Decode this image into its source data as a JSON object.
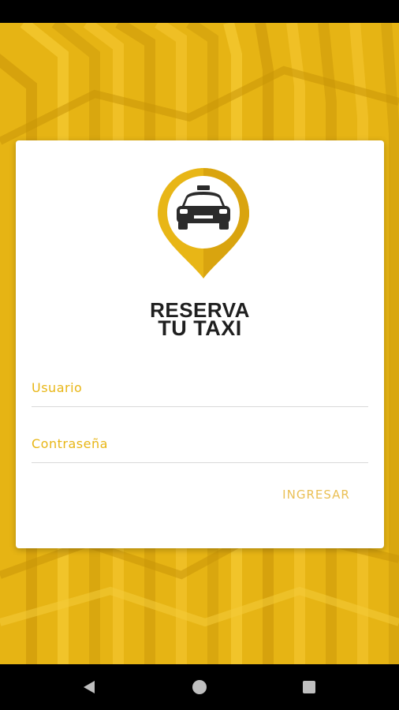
{
  "brand": {
    "line1": "RESERVA",
    "line2": "TU TAXI"
  },
  "form": {
    "username_placeholder": "Usuario",
    "password_placeholder": "Contraseña",
    "login_label": "INGRESAR"
  },
  "colors": {
    "accent": "#e8b616",
    "background": "#e8b616",
    "card": "#ffffff"
  },
  "icons": {
    "logo": "taxi-location-pin-icon",
    "nav_back": "back-triangle-icon",
    "nav_home": "home-circle-icon",
    "nav_recent": "recent-apps-square-icon"
  }
}
